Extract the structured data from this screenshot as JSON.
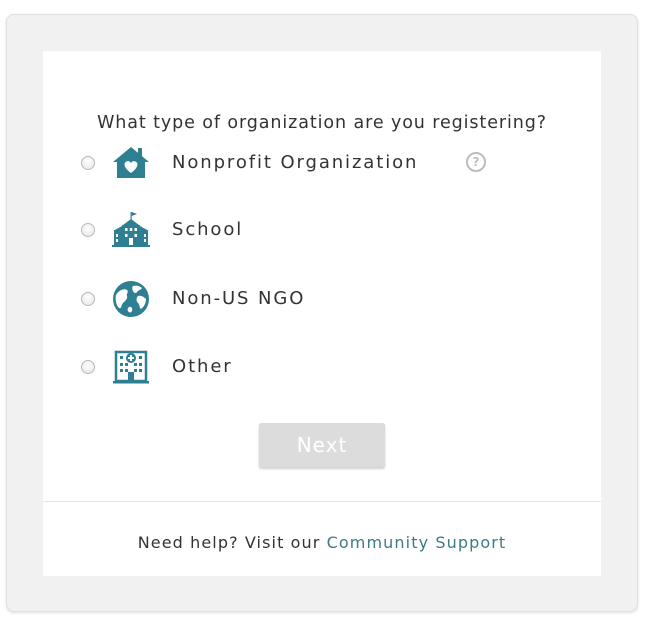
{
  "form": {
    "question": "What type of organization are you registering?",
    "options": [
      {
        "label": "Nonprofit Organization",
        "icon": "house-heart-icon",
        "has_help": true,
        "help_glyph": "?"
      },
      {
        "label": "School",
        "icon": "school-building-icon"
      },
      {
        "label": "Non-US NGO",
        "icon": "globe-icon"
      },
      {
        "label": "Other",
        "icon": "hospital-building-icon"
      }
    ],
    "next_label": "Next"
  },
  "footer": {
    "help_prefix": "Need help? Visit our",
    "help_link": "Community Support"
  },
  "colors": {
    "icon": "#2e7f91",
    "link": "#3d7a85",
    "button_disabled": "#dcdcdc",
    "text": "#333333"
  }
}
